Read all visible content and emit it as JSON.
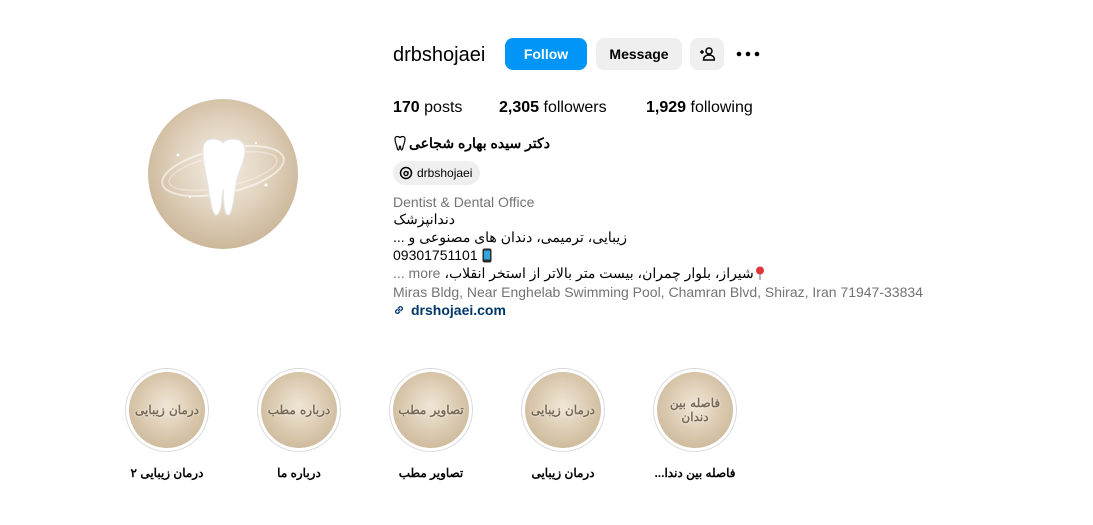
{
  "profile": {
    "username": "drbshojaei",
    "follow_label": "Follow",
    "message_label": "Message",
    "stats": {
      "posts_count": "170",
      "posts_label": "posts",
      "followers_count": "2,305",
      "followers_label": "followers",
      "following_count": "1,929",
      "following_label": "following"
    },
    "full_name": "دکتر سیده بهاره شجاعی",
    "threads_handle": "drbshojaei",
    "category": "Dentist & Dental Office",
    "bio_lines": [
      "دندانپزشک",
      "زیبایی، ترمیمی، دندان های مصنوعی و ...",
      "09301751101",
      "شیراز، بلوار چمران، بیست متر بالاتر از استخر انقلاب،",
      "... more"
    ],
    "address": "Miras Bldg, Near Enghelab Swimming Pool, Chamran Blvd, Shiraz, Iran 71947-33834",
    "website": "drshojaei.com"
  },
  "highlights": [
    {
      "cover_text": "درمان زیبایی",
      "label": "درمان زیبایی ۲"
    },
    {
      "cover_text": "درباره مطب",
      "label": "درباره ما"
    },
    {
      "cover_text": "تصاویر مطب",
      "label": "تصاویر مطب"
    },
    {
      "cover_text": "درمان زیبایی",
      "label": "درمان زیبایی"
    },
    {
      "cover_text": "فاصله بین دندان",
      "label": "فاصله بین دندا..."
    }
  ],
  "colors": {
    "follow_button": "#0095f6",
    "secondary_button": "#efefef",
    "link": "#00376b",
    "muted_text": "#737373"
  },
  "icons": {
    "add_user": "person-add-icon",
    "more": "more-options-icon",
    "tooth": "tooth-icon",
    "threads": "threads-icon",
    "link": "link-icon",
    "phone": "phone-icon",
    "pin": "location-pin-icon"
  }
}
